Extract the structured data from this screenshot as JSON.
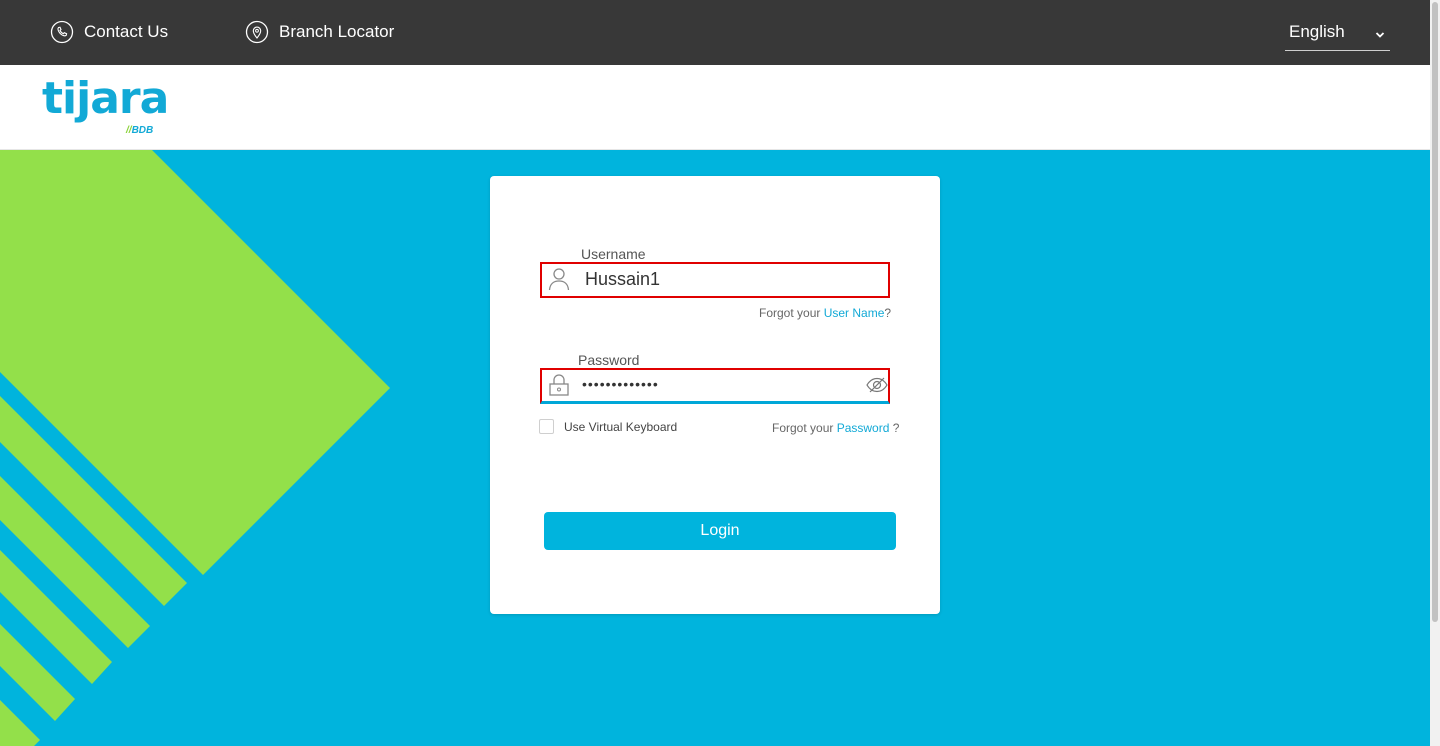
{
  "topbar": {
    "contact_label": "Contact Us",
    "contact_icon": "phone-icon",
    "branch_label": "Branch Locator",
    "branch_icon": "location-pin-icon",
    "language": "English"
  },
  "logo": {
    "main": "tijara",
    "sub_slash": "//",
    "sub": "BDB"
  },
  "login": {
    "username_label": "Username",
    "username_value": "Hussain1",
    "forgot_user_prefix": "Forgot your ",
    "forgot_user_link": "User Name",
    "forgot_user_suffix": "?",
    "password_label": "Password",
    "password_value": "•••••••••••••",
    "virtual_keyboard_label": "Use Virtual Keyboard",
    "forgot_pass_prefix": "Forgot your ",
    "forgot_pass_link": "Password",
    "forgot_pass_suffix": " ?",
    "button_label": "Login"
  },
  "colors": {
    "brand_blue": "#00b4dd",
    "brand_green": "#93e04a",
    "topbar": "#383838",
    "highlight_red": "#e00000"
  }
}
